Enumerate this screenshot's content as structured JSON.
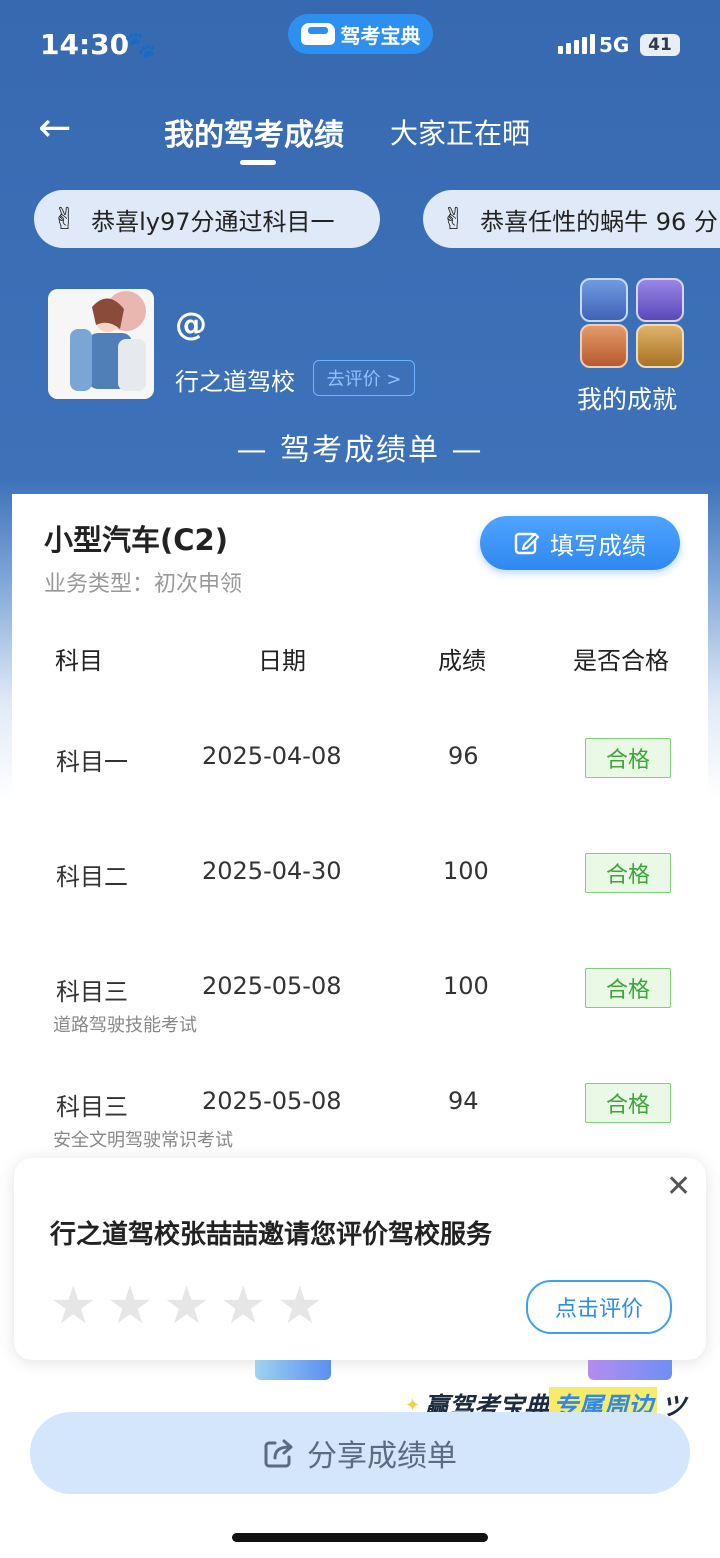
{
  "status": {
    "time": "14:30",
    "network": "5G",
    "battery": "41",
    "paw_icon": "paw-icon"
  },
  "brand": {
    "name": "驾考宝典"
  },
  "nav": {
    "tab_active": "我的驾考成绩",
    "tab_other": "大家正在晒"
  },
  "ticker": [
    {
      "emoji": "✌",
      "text": "恭喜ly97分通过科目一"
    },
    {
      "emoji": "✌",
      "text": "恭喜任性的蜗牛 96 分"
    }
  ],
  "profile": {
    "handle": "@",
    "school": "行之道驾校",
    "rate_label": "去评价 >",
    "achievements_label": "我的成就"
  },
  "report_title": "— 驾考成绩单 —",
  "license": {
    "type": "小型汽车(C2)",
    "business": "业务类型：初次申领",
    "fill_button": "填写成绩"
  },
  "table": {
    "headers": [
      "科目",
      "日期",
      "成绩",
      "是否合格"
    ],
    "rows": [
      {
        "subject": "科目一",
        "note": "",
        "date": "2025-04-08",
        "score": "96",
        "status": "合格"
      },
      {
        "subject": "科目二",
        "note": "",
        "date": "2025-04-30",
        "score": "100",
        "status": "合格"
      },
      {
        "subject": "科目三",
        "note": "道路驾驶技能考试",
        "date": "2025-05-08",
        "score": "100",
        "status": "合格"
      },
      {
        "subject": "科目三",
        "note": "安全文明驾驶常识考试",
        "date": "2025-05-08",
        "score": "94",
        "status": "合格"
      }
    ]
  },
  "popup": {
    "text": "行之道驾校张喆喆邀请您评价驾校服务",
    "button": "点击评价",
    "stars": 5
  },
  "promo": {
    "text_dark": "赢驾考宝典",
    "text_accent": "专属周边"
  },
  "share": {
    "label": "分享成绩单"
  },
  "colors": {
    "header_blue": "#3769b0",
    "accent_blue": "#2f88f0",
    "pass_green": "#3ea53a"
  }
}
